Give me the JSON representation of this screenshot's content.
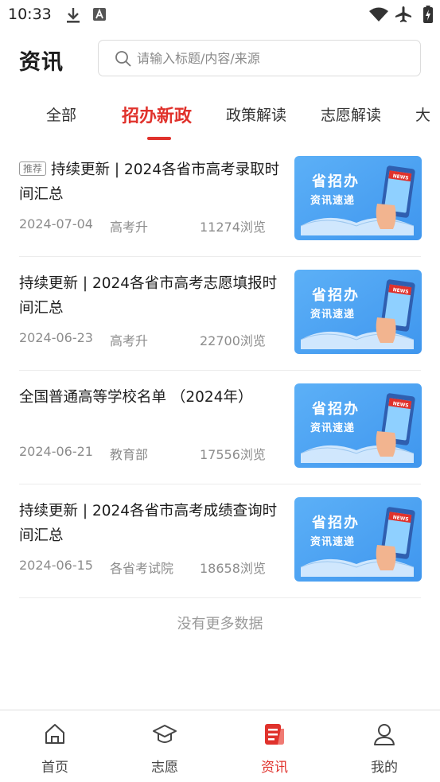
{
  "status_bar": {
    "time": "10:33"
  },
  "header": {
    "title": "资讯"
  },
  "search": {
    "placeholder": "请输入标题/内容/来源",
    "value": ""
  },
  "tabs": [
    {
      "label": "全部",
      "active": false
    },
    {
      "label": "招办新政",
      "active": true
    },
    {
      "label": "政策解读",
      "active": false
    },
    {
      "label": "志愿解读",
      "active": false
    },
    {
      "label": "大",
      "active": false
    }
  ],
  "news": [
    {
      "tag": "推荐",
      "title": "持续更新 | 2024各省市高考录取时间汇总",
      "date": "2024-07-04",
      "source": "高考升",
      "views": "11274浏览",
      "thumb_line1": "省招办",
      "thumb_line2": "资讯速递",
      "thumb_badge": "NEWS"
    },
    {
      "tag": "",
      "title": "持续更新 | 2024各省市高考志愿填报时间汇总",
      "date": "2024-06-23",
      "source": "高考升",
      "views": "22700浏览",
      "thumb_line1": "省招办",
      "thumb_line2": "资讯速递",
      "thumb_badge": "NEWS"
    },
    {
      "tag": "",
      "title": "全国普通高等学校名单 （2024年）",
      "date": "2024-06-21",
      "source": "教育部",
      "views": "17556浏览",
      "thumb_line1": "省招办",
      "thumb_line2": "资讯速递",
      "thumb_badge": "NEWS"
    },
    {
      "tag": "",
      "title": "持续更新 | 2024各省市高考成绩查询时间汇总",
      "date": "2024-06-15",
      "source": "各省考试院",
      "views": "18658浏览",
      "thumb_line1": "省招办",
      "thumb_line2": "资讯速递",
      "thumb_badge": "NEWS"
    }
  ],
  "list_footer": "没有更多数据",
  "bottom_nav": [
    {
      "label": "首页",
      "icon": "home-icon",
      "active": false
    },
    {
      "label": "志愿",
      "icon": "graduation-cap-icon",
      "active": false
    },
    {
      "label": "资讯",
      "icon": "news-icon",
      "active": true
    },
    {
      "label": "我的",
      "icon": "user-icon",
      "active": false
    }
  ],
  "colors": {
    "accent": "#e0322c",
    "thumb_blue": "#4aa3f3"
  }
}
